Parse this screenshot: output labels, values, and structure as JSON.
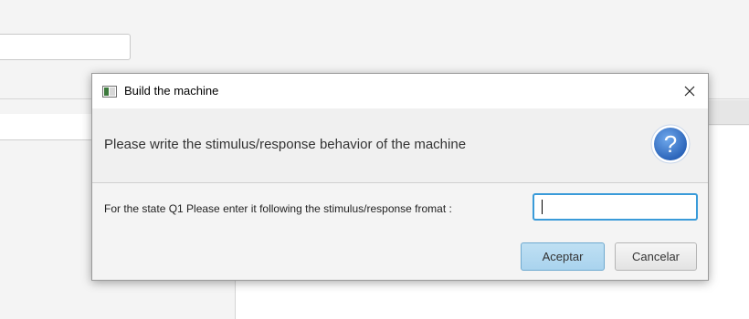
{
  "dialog": {
    "title": "Build the machine",
    "header_text": "Please write the stimulus/response behavior of the machine",
    "help_icon_glyph": "?",
    "prompt_label": "For the state Q1 Please enter it following the stimulus/response fromat :",
    "input_value": "",
    "accept_label": "Aceptar",
    "cancel_label": "Cancelar",
    "icons": {
      "app": "window-app-icon",
      "close": "close-icon",
      "help": "help-icon"
    }
  },
  "colors": {
    "accent": "#3a9bd9",
    "help_circle": "#2f6fc4",
    "accept_button": "#a9d3ee"
  }
}
